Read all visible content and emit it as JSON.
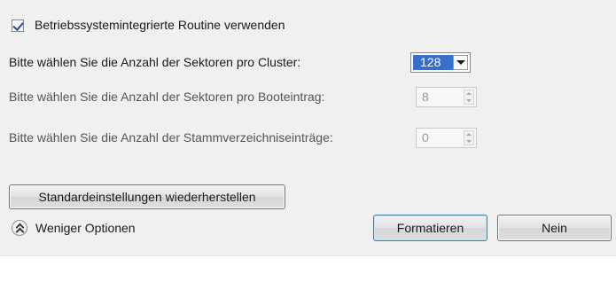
{
  "options": {
    "use_os_routine": {
      "label": "Betriebssystemintegrierte Routine verwenden",
      "checked": true
    },
    "sectors_per_cluster": {
      "label": "Bitte wählen Sie die Anzahl der Sektoren pro Cluster:",
      "value": "128",
      "icon": "dropdown-arrow-icon"
    },
    "sectors_per_boot_entry": {
      "label": "Bitte wählen Sie die Anzahl der Sektoren pro Booteintrag:",
      "value": "8",
      "enabled": false
    },
    "root_directory_entries": {
      "label": "Bitte wählen Sie die Anzahl der Stammverzeichniseinträge:",
      "value": "0",
      "enabled": false
    }
  },
  "buttons": {
    "restore_defaults": "Standardeinstellungen wiederherstellen",
    "format": "Formatieren",
    "no": "Nein"
  },
  "footer": {
    "fewer_options_label": "Weniger Optionen",
    "fewer_options_icon": "double-chevron-up-icon"
  },
  "colors": {
    "panel_bg": "#f0f0f0",
    "selection_blue": "#3a6fc9",
    "default_button_border": "#3c7fb1"
  }
}
